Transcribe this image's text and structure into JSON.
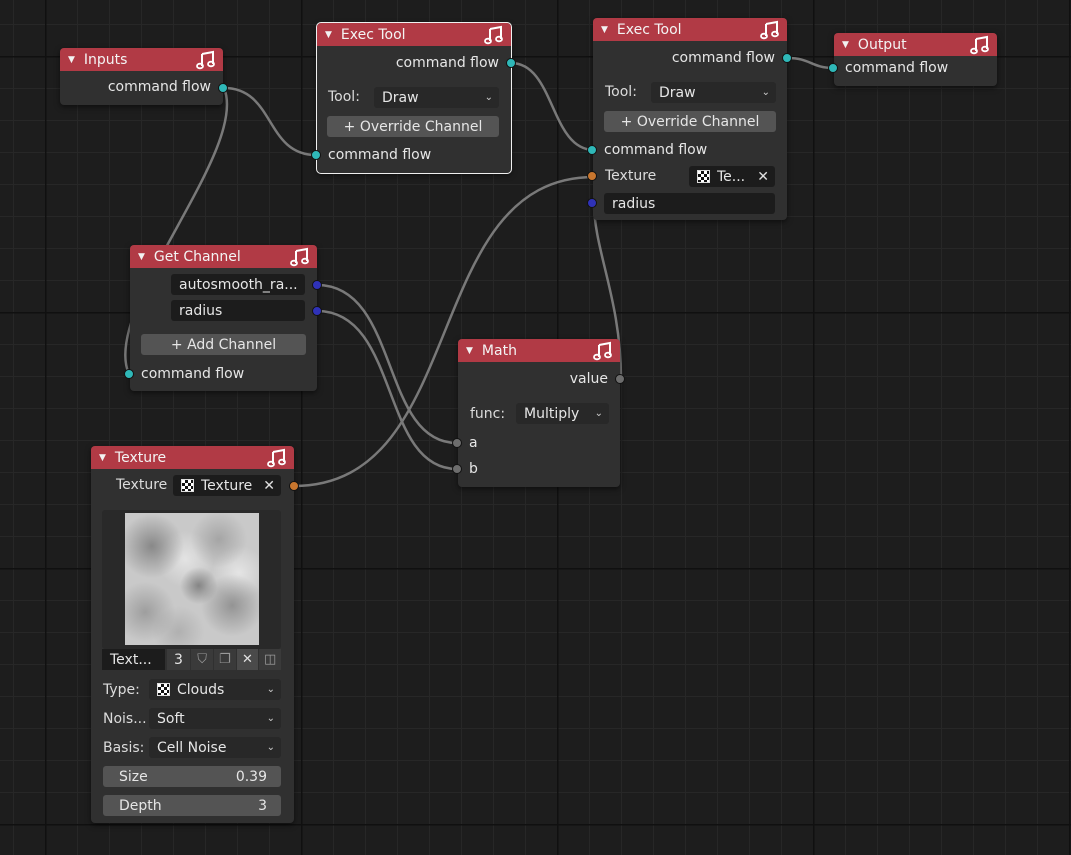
{
  "nodes": {
    "inputs": {
      "title": "Inputs",
      "out_command_flow": "command flow"
    },
    "exec1": {
      "title": "Exec Tool",
      "out_command_flow": "command flow",
      "tool_label": "Tool:",
      "tool_value": "Draw",
      "override_button": "+ Override Channel",
      "in_command_flow": "command flow"
    },
    "exec2": {
      "title": "Exec Tool",
      "out_command_flow": "command flow",
      "tool_label": "Tool:",
      "tool_value": "Draw",
      "override_button": "+ Override Channel",
      "in_command_flow": "command flow",
      "texture_label": "Texture",
      "texture_value": "Te...",
      "radius_value": "radius"
    },
    "output": {
      "title": "Output",
      "in_command_flow": "command flow"
    },
    "get_channel": {
      "title": "Get Channel",
      "channels": [
        "autosmooth_ra...",
        "radius"
      ],
      "add_button": "+ Add Channel",
      "in_command_flow": "command flow"
    },
    "math": {
      "title": "Math",
      "out_value": "value",
      "func_label": "func:",
      "func_value": "Multiply",
      "in_a": "a",
      "in_b": "b"
    },
    "texture": {
      "title": "Texture",
      "texture_label": "Texture",
      "texture_value": "Texture",
      "id_name": "Text...",
      "id_users": "3",
      "type_label": "Type:",
      "type_value": "Clouds",
      "noise_label": "Nois...",
      "noise_value": "Soft",
      "basis_label": "Basis:",
      "basis_value": "Cell Noise",
      "size_label": "Size",
      "size_value": "0.39",
      "depth_label": "Depth",
      "depth_value": "3"
    }
  },
  "socket_colors": {
    "command_flow": "#2fb8b8",
    "texture": "#c8762e",
    "float": "#2f32b8",
    "value": "#6d6d6d"
  },
  "header_color": "#b13a45",
  "icons": {
    "node_header": "music-note-icon",
    "collapse": "triangle-down-icon",
    "texture_slot": "checker-icon",
    "dropdown": "chevron-down-icon",
    "remove": "close-icon"
  }
}
